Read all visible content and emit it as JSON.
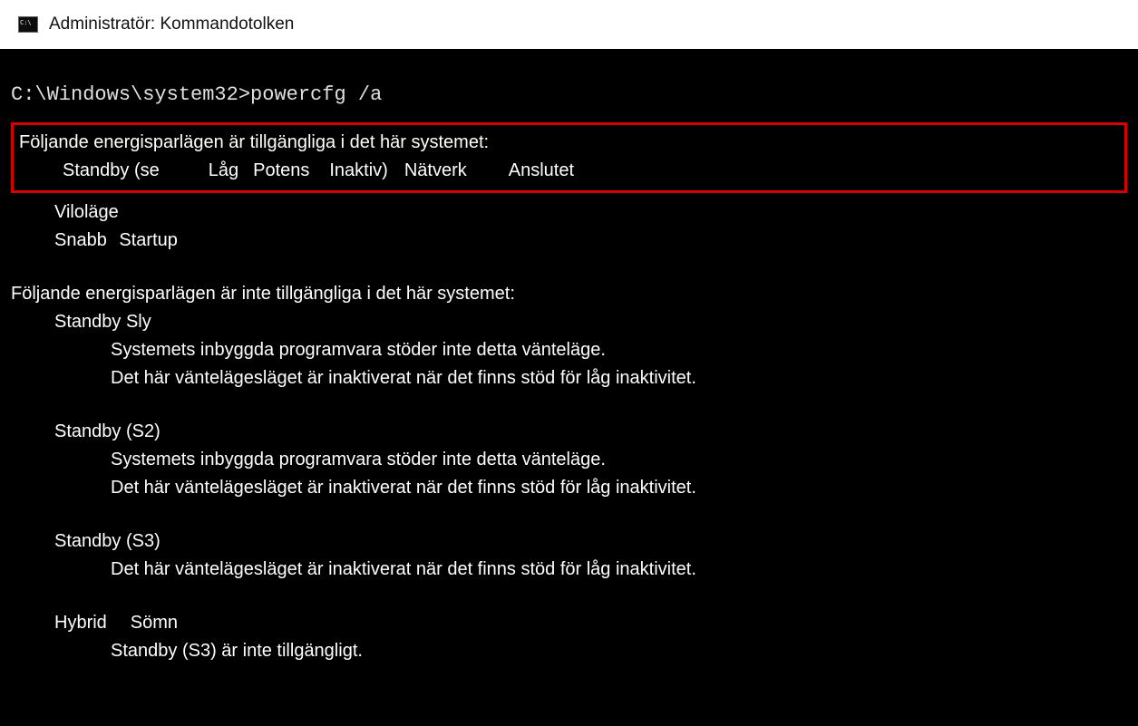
{
  "titlebar": {
    "text": "Administratör: Kommandotolken"
  },
  "prompt": "C:\\Windows\\system32>powercfg /a",
  "available": {
    "header": "Följande energisparlägen är tillgängliga i det här systemet:",
    "standby_row": {
      "lead": "Standby (se",
      "w1": "Låg",
      "w2": "Potens",
      "w3": "Inaktiv)",
      "w4": "Nätverk",
      "w5": "Anslutet"
    },
    "hibernate": "Viloläge",
    "fast_startup_a": "Snabb",
    "fast_startup_b": "Startup"
  },
  "unavailable": {
    "header": "Följande energisparlägen är inte tillgängliga i det här systemet:",
    "s1": {
      "title": "Standby Sly",
      "line1": "Systemets inbyggda programvara stöder inte detta vänteläge.",
      "line2": "Det här väntelägesläget är inaktiverat när det finns stöd för låg inaktivitet."
    },
    "s2": {
      "title": "Standby (S2)",
      "line1": "Systemets inbyggda programvara stöder inte detta vänteläge.",
      "line2": "Det här väntelägesläget är inaktiverat när det finns stöd för låg inaktivitet."
    },
    "s3": {
      "title": "Standby (S3)",
      "line1": "Det här väntelägesläget är inaktiverat när det finns stöd för låg inaktivitet."
    },
    "hybrid": {
      "a": "Hybrid",
      "b": "Sömn",
      "line1": "Standby (S3) är inte tillgängligt."
    }
  }
}
